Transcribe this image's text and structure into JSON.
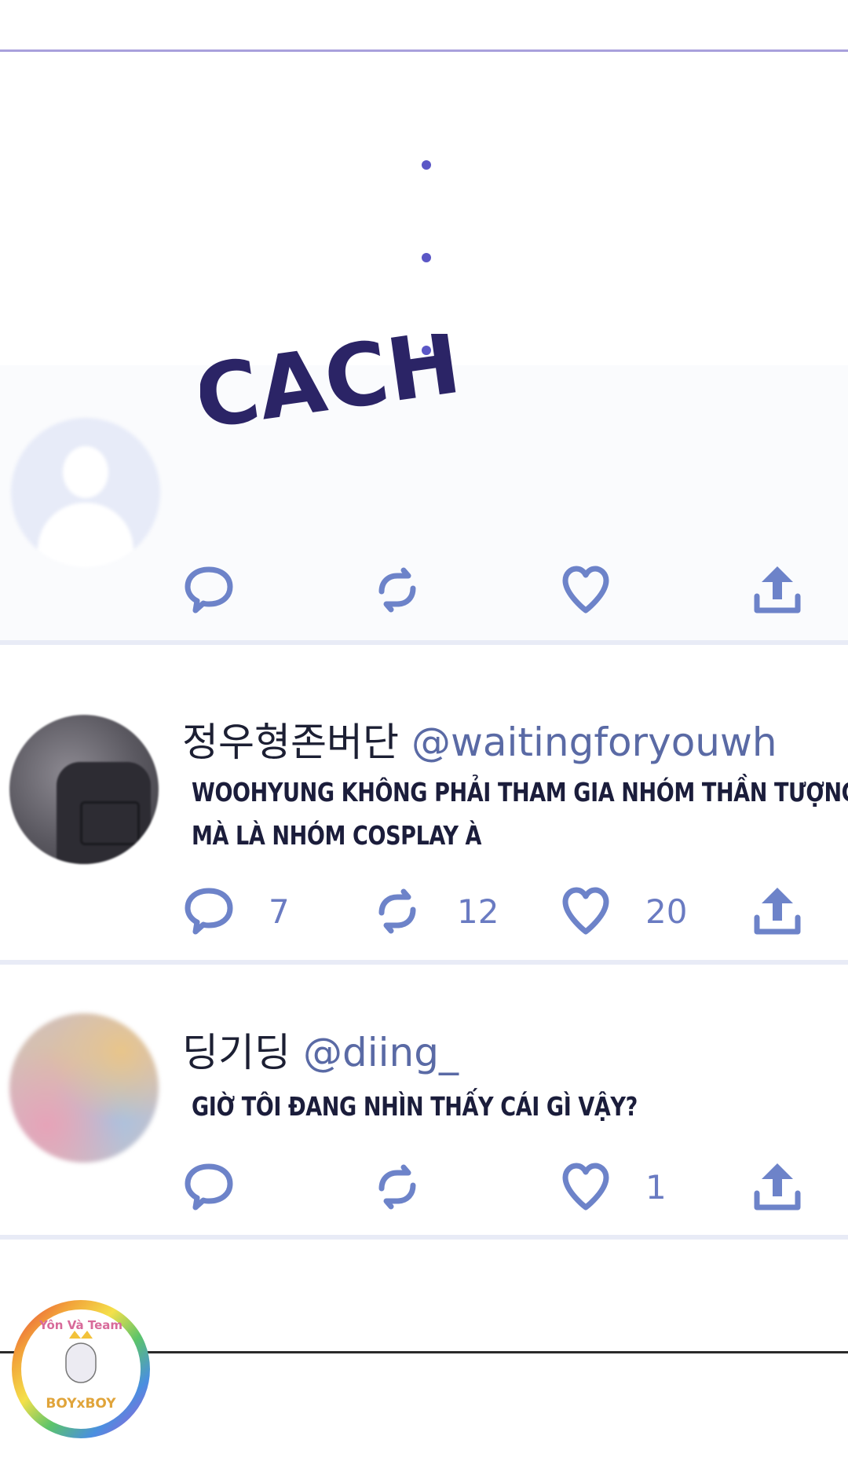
{
  "sound_effect": "CACH . .",
  "tweets": [
    {
      "name": "정우형존버단",
      "handle": "@waitingforyouwh",
      "text_line1": "WOOHYUNG KHÔNG PHẢI THAM GIA NHÓM THẦN TƯỢNG",
      "text_line2": "MÀ LÀ NHÓM COSPLAY À",
      "reply_count": "7",
      "retweet_count": "12",
      "like_count": "20"
    },
    {
      "name": "딩기딩",
      "handle": "@diing_",
      "text_line1": "GIỜ TÔI ĐANG NHÌN THẤY CÁI GÌ VẬY?",
      "like_count": "1"
    }
  ],
  "watermark": {
    "top_text": "Yôn Và Team",
    "bottom_text": "BOYxBOY"
  },
  "colors": {
    "accent": "#6d83c9",
    "handle": "#5a6aa5",
    "text": "#1b1d3b",
    "sfx": "#2b2466"
  }
}
